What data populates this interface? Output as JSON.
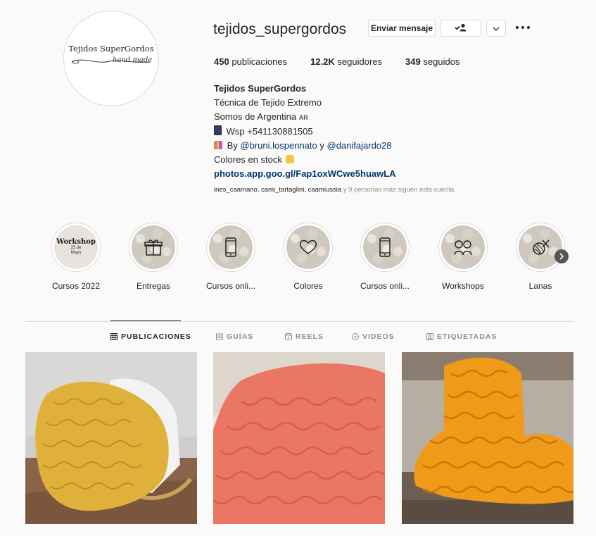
{
  "profile": {
    "username": "tejidos_supergordos",
    "logo_title": "Tejidos SuperGordos",
    "logo_sub": "hand made",
    "message_button": "Enviar mensaje"
  },
  "stats": {
    "posts_count": "450",
    "posts_label": "publicaciones",
    "followers_count": "12.2K",
    "followers_label": "seguidores",
    "following_count": "349",
    "following_label": "seguidos"
  },
  "bio": {
    "name": "Tejidos SuperGordos",
    "line1": "Técnica de Tejido Extremo",
    "line2": "Somos de Argentina",
    "flag": "AR",
    "line3": "Wsp +541130881505",
    "line4_prefix": "By",
    "mention1": "@bruni.lospennato",
    "line4_and": "y",
    "mention2": "@danifajardo28",
    "line5": "Colores en stock",
    "link": "photos.app.goo.gl/Fap1oxWCwe5huawLA"
  },
  "followed_by": {
    "names": "ines_caamano, cami_tartaglini, caamiussia",
    "suffix": "y 9 personas más siguen esta cuenta"
  },
  "highlights": [
    {
      "label": "Cursos 2022",
      "icon": "workshop-poster-icon",
      "poster_title": "Workshop",
      "poster_date": "25 de Mayo"
    },
    {
      "label": "Entregas",
      "icon": "gift-icon"
    },
    {
      "label": "Cursos onli...",
      "icon": "phone-icon"
    },
    {
      "label": "Colores",
      "icon": "heart-icon"
    },
    {
      "label": "Cursos onli...",
      "icon": "phone-icon"
    },
    {
      "label": "Workshops",
      "icon": "people-icon"
    },
    {
      "label": "Lanas",
      "icon": "yarn-ball-icon"
    }
  ],
  "tabs": [
    {
      "label": "PUBLICACIONES",
      "icon": "grid-icon",
      "active": true
    },
    {
      "label": "GUÍAS",
      "icon": "guide-icon",
      "active": false
    },
    {
      "label": "REELS",
      "icon": "reels-icon",
      "active": false
    },
    {
      "label": "VIDEOS",
      "icon": "video-icon",
      "active": false
    },
    {
      "label": "ETIQUETADAS",
      "icon": "tag-icon",
      "active": false
    }
  ],
  "posts": [
    {
      "subject": "mustard chunky knit blanket on rocking chair",
      "color": "#e0b13a"
    },
    {
      "subject": "coral chunky knit blanket",
      "color": "#ea7763"
    },
    {
      "subject": "orange chunky knit blanket on sofa",
      "color": "#f09a19"
    }
  ]
}
